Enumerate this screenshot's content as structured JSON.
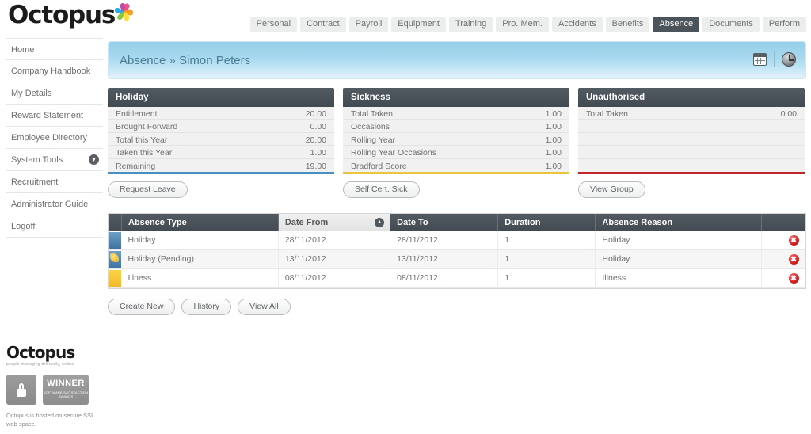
{
  "brand": {
    "name": "Octopus",
    "tagline": "people managing brilliantly, online",
    "logo_icon": "pinwheel-icon"
  },
  "topnav": {
    "items": [
      {
        "label": "Personal",
        "active": false
      },
      {
        "label": "Contract",
        "active": false
      },
      {
        "label": "Payroll",
        "active": false
      },
      {
        "label": "Equipment",
        "active": false
      },
      {
        "label": "Training",
        "active": false
      },
      {
        "label": "Pro. Mem.",
        "active": false
      },
      {
        "label": "Accidents",
        "active": false
      },
      {
        "label": "Benefits",
        "active": false
      },
      {
        "label": "Absence",
        "active": true
      },
      {
        "label": "Documents",
        "active": false
      },
      {
        "label": "Perform",
        "active": false
      }
    ]
  },
  "sidebar": {
    "items": [
      {
        "label": "Home",
        "has_chevron": false
      },
      {
        "label": "Company Handbook",
        "has_chevron": false
      },
      {
        "label": "My Details",
        "has_chevron": false
      },
      {
        "label": "Reward Statement",
        "has_chevron": false
      },
      {
        "label": "Employee Directory",
        "has_chevron": false
      },
      {
        "label": "System Tools",
        "has_chevron": true
      },
      {
        "label": "Recruitment",
        "has_chevron": false
      },
      {
        "label": "Administrator Guide",
        "has_chevron": false
      },
      {
        "label": "Logoff",
        "has_chevron": false
      }
    ],
    "chevron_glyph": "▾"
  },
  "banner": {
    "section": "Absence",
    "separator": "»",
    "person": "Simon Peters",
    "calendar_icon": "calendar-icon",
    "clock_icon": "clock-icon"
  },
  "panels": [
    {
      "title": "Holiday",
      "accent": "#4a8fc2",
      "button": "Request Leave",
      "rows": [
        {
          "label": "Entitlement",
          "value": "20.00"
        },
        {
          "label": "Brought Forward",
          "value": "0.00"
        },
        {
          "label": "Total this Year",
          "value": "20.00"
        },
        {
          "label": "Taken this Year",
          "value": "1.00"
        },
        {
          "label": "Remaining",
          "value": "19.00"
        }
      ]
    },
    {
      "title": "Sickness",
      "accent": "#ecc53e",
      "button": "Self Cert. Sick",
      "rows": [
        {
          "label": "Total Taken",
          "value": "1.00"
        },
        {
          "label": "Occasions",
          "value": "1.00"
        },
        {
          "label": "Rolling Year",
          "value": "1.00"
        },
        {
          "label": "Rolling Year Occasions",
          "value": "1.00"
        },
        {
          "label": "Bradford Score",
          "value": "1.00"
        }
      ]
    },
    {
      "title": "Unauthorised",
      "accent": "#c0262b",
      "button": "View Group",
      "rows": [
        {
          "label": "Total Taken",
          "value": "0.00"
        },
        {
          "label": "",
          "value": ""
        },
        {
          "label": "",
          "value": ""
        },
        {
          "label": "",
          "value": ""
        },
        {
          "label": "",
          "value": ""
        }
      ]
    }
  ],
  "table": {
    "columns": [
      {
        "label": "Absence Type",
        "sorted": false
      },
      {
        "label": "Date From",
        "sorted": true
      },
      {
        "label": "Date To",
        "sorted": false
      },
      {
        "label": "Duration",
        "sorted": false
      },
      {
        "label": "Absence Reason",
        "sorted": false
      }
    ],
    "sort_glyph": "▲",
    "delete_glyph": "✖",
    "rows": [
      {
        "swatch": "blue",
        "pending": false,
        "type": "Holiday",
        "date_from": "28/11/2012",
        "date_to": "28/11/2012",
        "duration": "1",
        "reason": "Holiday"
      },
      {
        "swatch": "blue",
        "pending": true,
        "type": "Holiday (Pending)",
        "date_from": "13/11/2012",
        "date_to": "13/11/2012",
        "duration": "1",
        "reason": "Holiday"
      },
      {
        "swatch": "yellow",
        "pending": false,
        "type": "Illness",
        "date_from": "08/11/2012",
        "date_to": "08/11/2012",
        "duration": "1",
        "reason": "Illness"
      }
    ]
  },
  "bottom_buttons": [
    {
      "label": "Create New"
    },
    {
      "label": "History"
    },
    {
      "label": "View All"
    }
  ],
  "footer": {
    "lock_icon": "padlock-icon",
    "winner_title": "WINNER",
    "winner_sub": "SOFTWARE SATISFACTION AWARDS",
    "note": "Octopus is hosted on secure SSL web space."
  }
}
